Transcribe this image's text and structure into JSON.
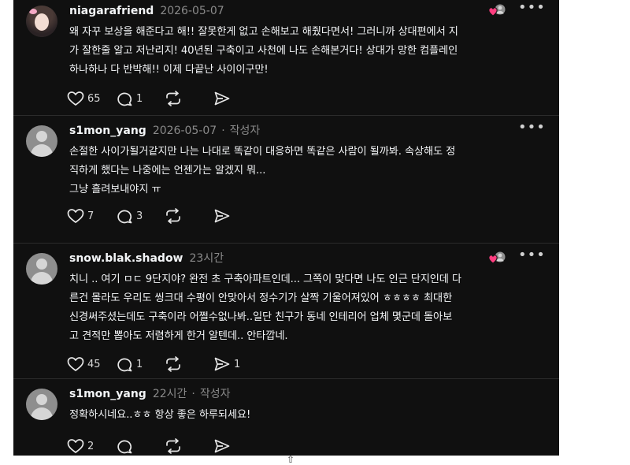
{
  "comments": [
    {
      "username": "niagarafriend",
      "time": "2026-05-07",
      "author_tag": "",
      "text": "왜 자꾸 보상을 해준다고 해!! 잘못한게 없고 손해보고 해줬다면서! 그러니까 상대편에서 지\n가 잘한줄 알고 저난리지! 40년된 구축이고 사천에 나도 손해본거다! 상대가 망한 컴플레인\n하나하나 다 반박해!! 이제 다끝난 사이이구만!",
      "likes": "65",
      "replies": "1",
      "reposts": "",
      "shares": "",
      "avatar": "photo",
      "liked_by_author": true
    },
    {
      "username": "s1mon_yang",
      "time": "2026-05-07",
      "author_tag": "작성자",
      "text": "손절한 사이가될거같지만 나는 나대로 똑같이 대응하면 똑같은 사람이 될까봐. 속상해도 정\n직하게 했다는 나중에는 언젠가는 알겠지 뭐...\n그냥 흘려보내야지 ㅠ",
      "likes": "7",
      "replies": "3",
      "reposts": "",
      "shares": "",
      "avatar": "default",
      "liked_by_author": false
    },
    {
      "username": "snow.blak.shadow",
      "time": "23시간",
      "author_tag": "",
      "text": "치니 .. 여기 ㅁㄷ 9단지야? 완전 초 구축아파트인데... 그쪽이 맞다면 나도 인근 단지인데 다\n른건 몰라도 우리도 씽크대 수평이 안맞아서 정수기가 살짝 기울어져있어 ㅎㅎㅎㅎ 최대한\n신경써주셨는데도 구축이라 어쩔수없나봐..일단 친구가 동네 인테리어 업체 몇군데 돌아보\n고 견적만 뽑아도 저렴하게 한거 알텐데.. 안타깝네.",
      "likes": "45",
      "replies": "1",
      "reposts": "",
      "shares": "1",
      "avatar": "default",
      "liked_by_author": true
    },
    {
      "username": "s1mon_yang",
      "time": "22시간",
      "author_tag": "작성자",
      "text": "정확하시네요..ㅎㅎ 항상 좋은 하루되세요!",
      "likes": "2",
      "replies": "",
      "reposts": "",
      "shares": "",
      "avatar": "default",
      "liked_by_author": false
    }
  ],
  "icons": {
    "more": "more-options-icon",
    "like": "heart-icon",
    "reply": "comment-icon",
    "repost": "repost-icon",
    "share": "send-icon",
    "liked_by_author": "liked-by-author-badge-icon"
  },
  "colors": {
    "background": "#101010",
    "text": "#f3f5f7",
    "secondary": "#8a8a8a",
    "heart_badge": "#ff3d7f"
  }
}
